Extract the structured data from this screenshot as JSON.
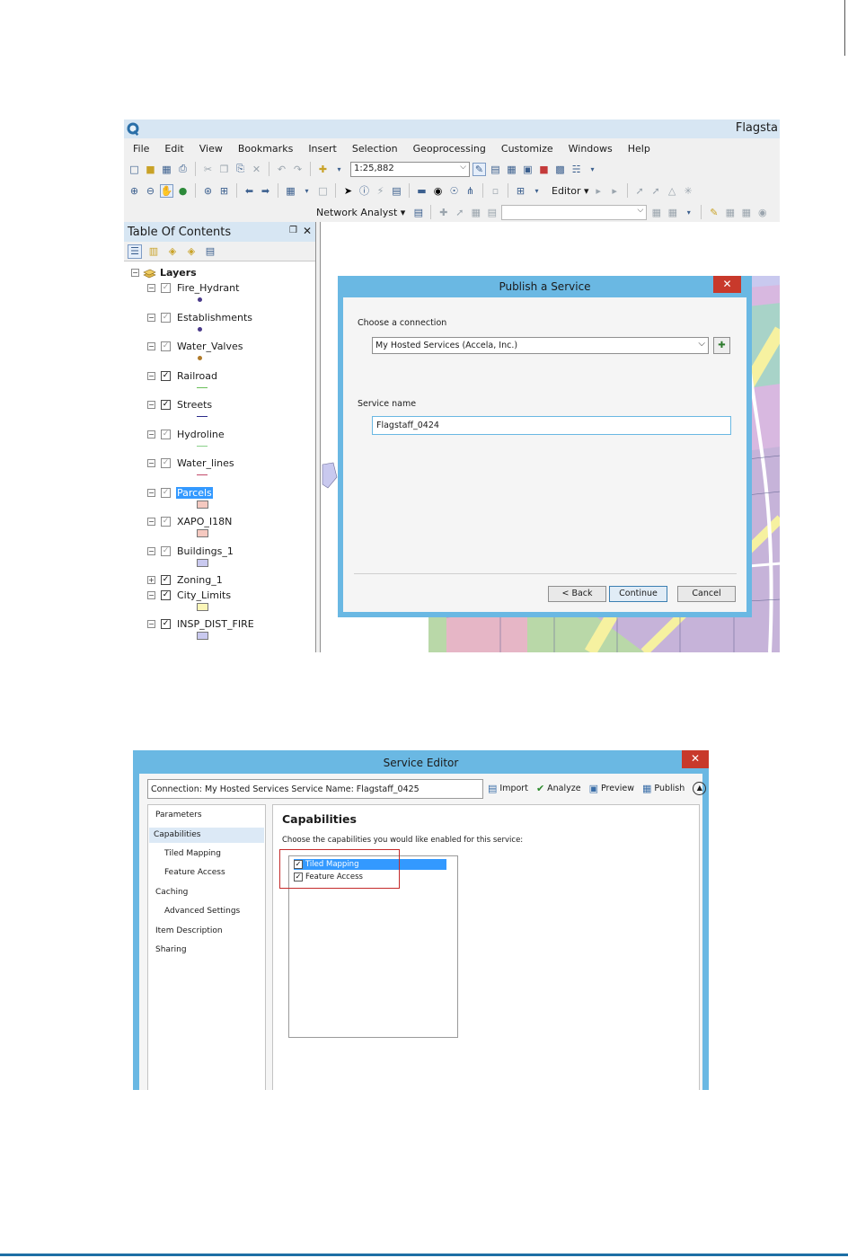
{
  "arcmap": {
    "window_title": "Flagsta",
    "menu": [
      "File",
      "Edit",
      "View",
      "Bookmarks",
      "Insert",
      "Selection",
      "Geoprocessing",
      "Customize",
      "Windows",
      "Help"
    ],
    "scale": "1:25,882",
    "editor_label": "Editor ▾",
    "network_analyst_label": "Network Analyst ▾",
    "toc": {
      "title": "Table Of Contents",
      "pin_icon": "❒",
      "close_icon": "✕",
      "root_label": "Layers",
      "layers": [
        {
          "name": "Fire_Hydrant",
          "checked": false,
          "symbol": "dot",
          "color": "#4a3a8a",
          "selected": false,
          "expand": "−"
        },
        {
          "name": "Establishments",
          "checked": false,
          "symbol": "dot",
          "color": "#4a3a8a",
          "selected": false,
          "expand": "−"
        },
        {
          "name": "Water_Valves",
          "checked": false,
          "symbol": "dot",
          "color": "#b07a2a",
          "selected": false,
          "expand": "−"
        },
        {
          "name": "Railroad",
          "checked": true,
          "symbol": "line",
          "color": "#6abf5a",
          "selected": false,
          "expand": "−"
        },
        {
          "name": "Streets",
          "checked": true,
          "symbol": "line",
          "color": "#2a2a8a",
          "selected": false,
          "expand": "−"
        },
        {
          "name": "Hydroline",
          "checked": false,
          "symbol": "line",
          "color": "#8ad08a",
          "selected": false,
          "expand": "−"
        },
        {
          "name": "Water_lines",
          "checked": false,
          "symbol": "line",
          "color": "#c24a6a",
          "selected": false,
          "expand": "−"
        },
        {
          "name": "Parcels",
          "checked": false,
          "symbol": "fill",
          "color": "#f5c9c0",
          "selected": true,
          "expand": "−"
        },
        {
          "name": "XAPO_I18N",
          "checked": false,
          "symbol": "fill",
          "color": "#f5c9c0",
          "selected": false,
          "expand": "−"
        },
        {
          "name": "Buildings_1",
          "checked": false,
          "symbol": "fill",
          "color": "#c9c9ef",
          "selected": false,
          "expand": "−"
        },
        {
          "name": "Zoning_1",
          "checked": true,
          "symbol": "none",
          "color": "",
          "selected": false,
          "expand": "+"
        },
        {
          "name": "City_Limits",
          "checked": true,
          "symbol": "fill",
          "color": "#fbf6b8",
          "selected": false,
          "expand": "−"
        },
        {
          "name": "INSP_DIST_FIRE",
          "checked": true,
          "symbol": "fill",
          "color": "#c9c9ef",
          "selected": false,
          "expand": "−"
        }
      ]
    }
  },
  "publish_dialog": {
    "title": "Publish a Service",
    "close_label": "✕",
    "connection_label": "Choose a connection",
    "connection_value": "My Hosted Services (Accela, Inc.)",
    "service_name_label": "Service name",
    "service_name_value": "Flagstaff_0424",
    "back_label": "< Back",
    "continue_label": "Continue",
    "cancel_label": "Cancel"
  },
  "service_editor": {
    "title": "Service Editor",
    "close_label": "✕",
    "connection_text": "Connection: My Hosted Services   Service Name: Flagstaff_0425",
    "actions": {
      "import": "Import",
      "analyze": "Analyze",
      "preview": "Preview",
      "publish": "Publish"
    },
    "nav": [
      "Parameters",
      "Capabilities",
      "Tiled Mapping",
      "Feature Access",
      "Caching",
      "Advanced Settings",
      "Item Description",
      "Sharing"
    ],
    "active_nav": "Capabilities",
    "capabilities_title": "Capabilities",
    "capabilities_instruction": "Choose the capabilities you would like enabled for this service:",
    "capabilities": [
      {
        "label": "Tiled Mapping",
        "checked": true,
        "selected": true
      },
      {
        "label": "Feature Access",
        "checked": true,
        "selected": false
      }
    ]
  },
  "colors": {
    "dialog_frame": "#6ab8e3",
    "close_button": "#c8392b",
    "selection": "#3399ff",
    "highlight_box": "#c42b2b",
    "footer_rule": "#1d6fa5"
  }
}
